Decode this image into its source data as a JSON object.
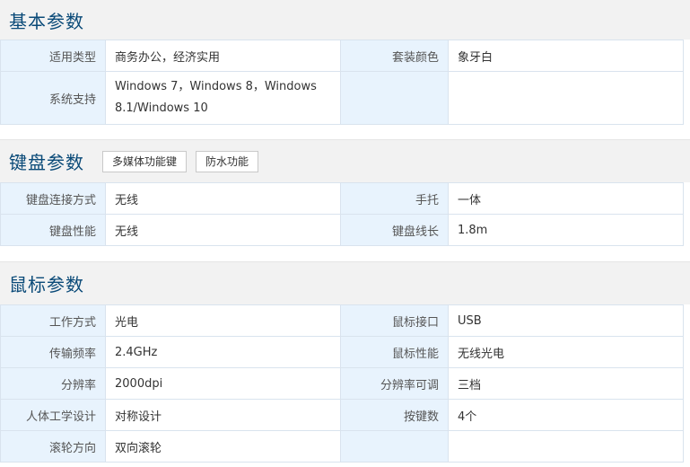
{
  "sections": [
    {
      "title": "基本参数",
      "tags": [],
      "rows": [
        {
          "k1": "适用类型",
          "v1": "商务办公，经济实用",
          "k2": "套装颜色",
          "v2": "象牙白"
        },
        {
          "k1": "系统支持",
          "v1": "Windows 7，Windows 8，Windows 8.1/Windows 10",
          "k2": "",
          "v2": ""
        }
      ]
    },
    {
      "title": "键盘参数",
      "tags": [
        "多媒体功能键",
        "防水功能"
      ],
      "rows": [
        {
          "k1": "键盘连接方式",
          "v1": "无线",
          "k2": "手托",
          "v2": "一体"
        },
        {
          "k1": "键盘性能",
          "v1": "无线",
          "k2": "键盘线长",
          "v2": "1.8m"
        }
      ]
    },
    {
      "title": "鼠标参数",
      "tags": [],
      "rows": [
        {
          "k1": "工作方式",
          "v1": "光电",
          "k2": "鼠标接口",
          "v2": "USB"
        },
        {
          "k1": "传输频率",
          "v1": "2.4GHz",
          "k2": "鼠标性能",
          "v2": "无线光电"
        },
        {
          "k1": "分辨率",
          "v1": "2000dpi",
          "k2": "分辨率可调",
          "v2": "三档"
        },
        {
          "k1": "人体工学设计",
          "v1": "对称设计",
          "k2": "按键数",
          "v2": "4个"
        },
        {
          "k1": "滚轮方向",
          "v1": "双向滚轮",
          "k2": "",
          "v2": ""
        }
      ]
    }
  ]
}
